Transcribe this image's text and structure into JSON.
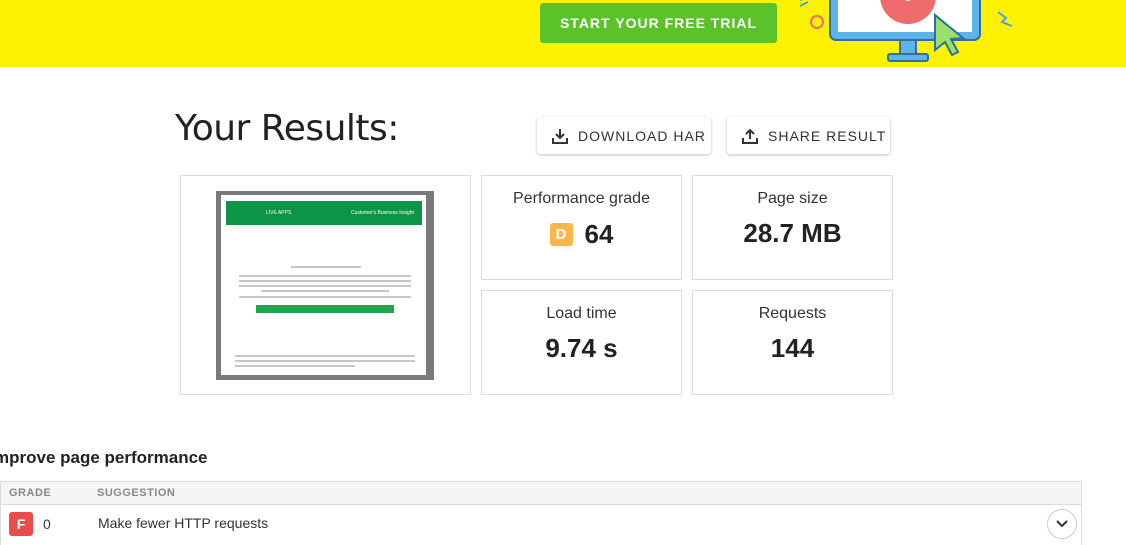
{
  "banner": {
    "cta_label": "START YOUR FREE TRIAL",
    "background": "#fff200",
    "cta_color": "#5cc22a"
  },
  "results": {
    "title": "Your Results:",
    "download_label": "DOWNLOAD HAR",
    "share_label": "SHARE RESULT"
  },
  "screenshot": {
    "header_left": "LIVE APPS",
    "header_right": "Customer's Business Insight"
  },
  "metrics": {
    "performance": {
      "label": "Performance grade",
      "grade": "D",
      "score": "64",
      "grade_color": "#f8b64c"
    },
    "page_size": {
      "label": "Page size",
      "value": "28.7 MB"
    },
    "load_time": {
      "label": "Load time",
      "value": "9.74 s"
    },
    "requests": {
      "label": "Requests",
      "value": "144"
    }
  },
  "improve": {
    "title": "mprove page performance",
    "columns": [
      "GRADE",
      "SUGGESTION"
    ],
    "rows": [
      {
        "grade": "F",
        "score": "0",
        "suggestion": "Make fewer HTTP requests",
        "grade_color": "#e84c4c"
      }
    ]
  },
  "icons": {
    "download": "download-icon",
    "share": "share-icon",
    "expand": "chevron-down-icon"
  }
}
